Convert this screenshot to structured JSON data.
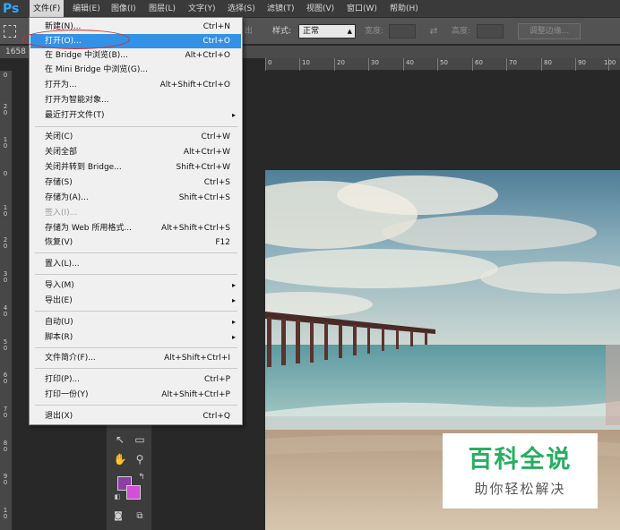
{
  "app": {
    "logo": "Ps"
  },
  "menubar": {
    "items": [
      "文件(F)",
      "编辑(E)",
      "图像(I)",
      "图层(L)",
      "文字(Y)",
      "选择(S)",
      "滤镜(T)",
      "视图(V)",
      "窗口(W)",
      "帮助(H)"
    ]
  },
  "options": {
    "partial_text": "出",
    "style_label": "样式:",
    "style_value": "正常",
    "width_label": "宽度:",
    "height_label": "高度:",
    "refine_button": "调整边缘..."
  },
  "doc": {
    "tab_partial": "1658"
  },
  "ruler": {
    "h_labels": [
      "0",
      "10",
      "20",
      "30",
      "40",
      "50",
      "60",
      "70",
      "80",
      "90",
      "100"
    ],
    "v_labels": [
      "0",
      "2 0",
      "1 0",
      "0",
      "1 0",
      "2 0",
      "3 0",
      "4 0",
      "5 0",
      "6 0",
      "7 0",
      "8 0",
      "9 0",
      "1 0"
    ]
  },
  "file_menu": {
    "items": [
      {
        "label": "新建(N)...",
        "shortcut": "Ctrl+N"
      },
      {
        "label": "打开(O)...",
        "shortcut": "Ctrl+O",
        "highlighted": true
      },
      {
        "label": "在 Bridge 中浏览(B)...",
        "shortcut": "Alt+Ctrl+O"
      },
      {
        "label": "在 Mini Bridge 中浏览(G)...",
        "shortcut": ""
      },
      {
        "label": "打开为...",
        "shortcut": "Alt+Shift+Ctrl+O"
      },
      {
        "label": "打开为智能对象...",
        "shortcut": ""
      },
      {
        "label": "最近打开文件(T)",
        "shortcut": "",
        "submenu": true
      },
      {
        "label": "关闭(C)",
        "shortcut": "Ctrl+W"
      },
      {
        "label": "关闭全部",
        "shortcut": "Alt+Ctrl+W"
      },
      {
        "label": "关闭并转到 Bridge...",
        "shortcut": "Shift+Ctrl+W"
      },
      {
        "label": "存储(S)",
        "shortcut": "Ctrl+S"
      },
      {
        "label": "存储为(A)...",
        "shortcut": "Shift+Ctrl+S"
      },
      {
        "label": "签入(I)...",
        "shortcut": "",
        "disabled": true
      },
      {
        "label": "存储为 Web 所用格式...",
        "shortcut": "Alt+Shift+Ctrl+S"
      },
      {
        "label": "恢复(V)",
        "shortcut": "F12"
      },
      {
        "label": "置入(L)...",
        "shortcut": ""
      },
      {
        "label": "导入(M)",
        "shortcut": "",
        "submenu": true
      },
      {
        "label": "导出(E)",
        "shortcut": "",
        "submenu": true
      },
      {
        "label": "自动(U)",
        "shortcut": "",
        "submenu": true
      },
      {
        "label": "脚本(R)",
        "shortcut": "",
        "submenu": true
      },
      {
        "label": "文件简介(F)...",
        "shortcut": "Alt+Shift+Ctrl+I"
      },
      {
        "label": "打印(P)...",
        "shortcut": "Ctrl+P"
      },
      {
        "label": "打印一份(Y)",
        "shortcut": "Alt+Shift+Ctrl+P"
      },
      {
        "label": "退出(X)",
        "shortcut": "Ctrl+Q"
      }
    ]
  },
  "swatches": {
    "foreground": "#8b3fa6",
    "background": "#d24fd6"
  },
  "watermark": {
    "title": "百科全说",
    "subtitle": "助你轻松解决"
  }
}
